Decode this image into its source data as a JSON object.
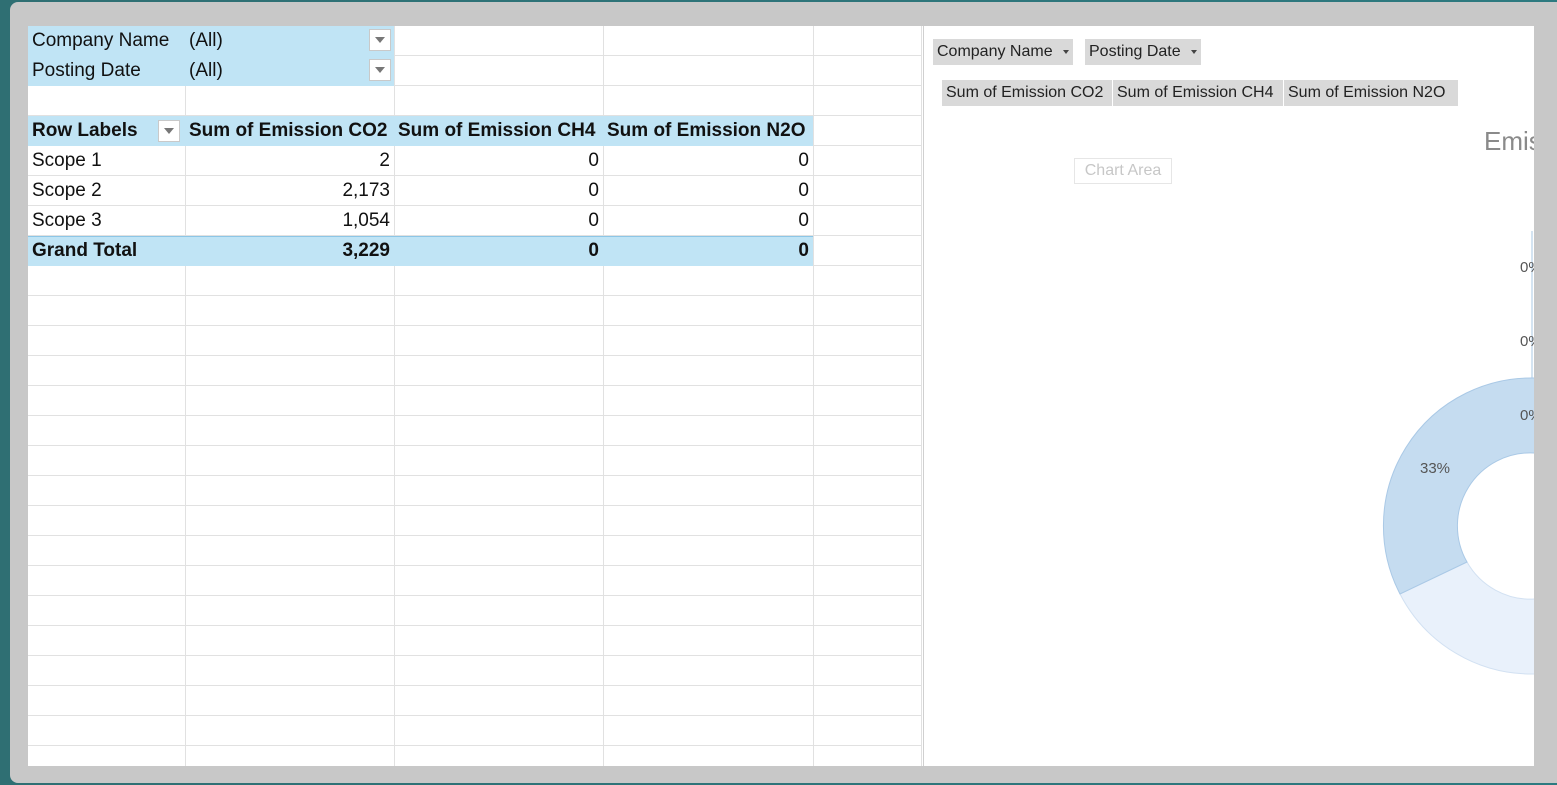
{
  "filters": [
    {
      "label": "Company Name",
      "value": "(All)"
    },
    {
      "label": "Posting Date",
      "value": "(All)"
    }
  ],
  "pivot": {
    "headers": [
      "Row Labels",
      "Sum of Emission CO2",
      "Sum of Emission CH4",
      "Sum of Emission N2O"
    ],
    "rows": [
      {
        "label": "Scope 1",
        "co2": "2",
        "ch4": "0",
        "n2o": "0"
      },
      {
        "label": "Scope 2",
        "co2": "2,173",
        "ch4": "0",
        "n2o": "0"
      },
      {
        "label": "Scope 3",
        "co2": "1,054",
        "ch4": "0",
        "n2o": "0"
      }
    ],
    "total": {
      "label": "Grand Total",
      "co2": "3,229",
      "ch4": "0",
      "n2o": "0"
    }
  },
  "chart": {
    "filter_buttons": [
      "Company Name",
      "Posting Date"
    ],
    "value_buttons": [
      "Sum of Emission CO2",
      "Sum of Emission CH4",
      "Sum of Emission N2O"
    ],
    "tooltip": "Chart Area",
    "title": "Emis",
    "labels": [
      "0%",
      "0%",
      "0%",
      "33%"
    ]
  },
  "colors": {
    "pivot_header": "#c0e4f5",
    "donut_main": "#c5dcf0",
    "donut_light": "#e9f1fb"
  }
}
